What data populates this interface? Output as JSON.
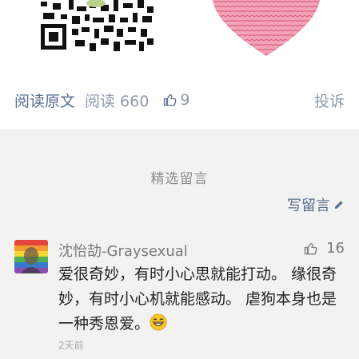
{
  "article": {
    "read_original_label": "阅读原文",
    "read_count_label": "阅读 660",
    "like_count": "9",
    "report_label": "投诉"
  },
  "comments_section": {
    "title": "精选留言",
    "write_label": "写留言"
  },
  "comment": {
    "nickname": "沈怡劼-Graysexual",
    "likes": "16",
    "text": "爱很奇妙，有时小心思就能打动。 缘很奇妙，有时小心机就能感动。 虐狗本身也是一种秀恩爱。",
    "emoji": "grinning-face",
    "time": "2天前"
  },
  "colors": {
    "link": "#596f8f",
    "muted": "#8f9aa8",
    "panel": "#f2f2f2"
  }
}
